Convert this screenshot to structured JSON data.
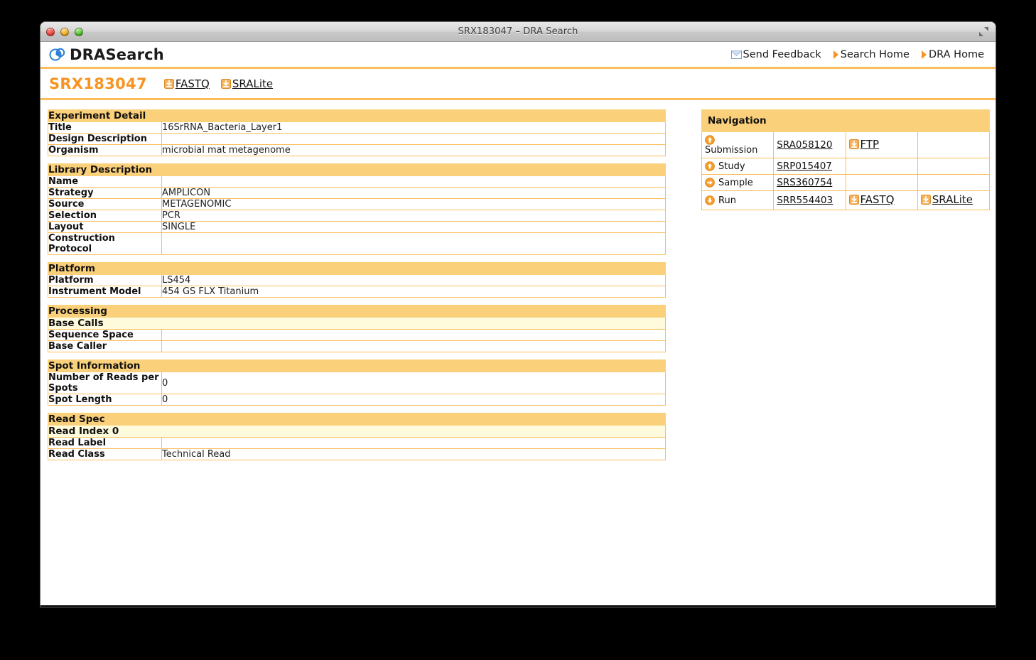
{
  "window": {
    "title": "SRX183047 – DRA Search",
    "controls": [
      "close",
      "minimize",
      "zoom"
    ],
    "fullscreen_icon": "fullscreen-icon"
  },
  "header": {
    "brand": "DRASearch",
    "logo_icon": "dra-logo-icon",
    "links": [
      {
        "label": "Send Feedback",
        "icon": "mail-icon"
      },
      {
        "label": "Search Home",
        "icon": "triangle-right-icon"
      },
      {
        "label": "DRA Home",
        "icon": "triangle-right-icon"
      }
    ]
  },
  "id_bar": {
    "accession": "SRX183047",
    "downloads": [
      {
        "label": "FASTQ",
        "icon": "download-icon"
      },
      {
        "label": "SRALite",
        "icon": "download-icon"
      }
    ]
  },
  "sections": [
    {
      "title": "Experiment Detail",
      "rows": [
        {
          "key": "Title",
          "value": "16SrRNA_Bacteria_Layer1"
        },
        {
          "key": "Design Description",
          "value": ""
        },
        {
          "key": "Organism",
          "value": "microbial mat metagenome"
        }
      ]
    },
    {
      "title": "Library Description",
      "rows": [
        {
          "key": "Name",
          "value": ""
        },
        {
          "key": "Strategy",
          "value": "AMPLICON"
        },
        {
          "key": "Source",
          "value": "METAGENOMIC"
        },
        {
          "key": "Selection",
          "value": "PCR"
        },
        {
          "key": "Layout",
          "value": "SINGLE"
        },
        {
          "key": "Construction Protocol",
          "value": ""
        }
      ]
    },
    {
      "title": "Platform",
      "rows": [
        {
          "key": "Platform",
          "value": "LS454"
        },
        {
          "key": "Instrument Model",
          "value": "454 GS FLX Titanium"
        }
      ]
    },
    {
      "title": "Processing",
      "rows": [
        {
          "key": "Base Calls",
          "value": "",
          "subhead": true
        },
        {
          "key": "Sequence Space",
          "value": ""
        },
        {
          "key": "Base Caller",
          "value": ""
        }
      ]
    },
    {
      "title": "Spot Information",
      "rows": [
        {
          "key": "Number of Reads per Spots",
          "value": "0"
        },
        {
          "key": "Spot Length",
          "value": "0"
        }
      ]
    },
    {
      "title": "Read Spec",
      "rows": [
        {
          "key": "Read Index 0",
          "value": "",
          "subhead": true
        },
        {
          "key": "Read Label",
          "value": ""
        },
        {
          "key": "Read Class",
          "value": "Technical Read"
        }
      ]
    }
  ],
  "navigation": {
    "title": "Navigation",
    "rows": [
      {
        "arrow": "arrow-up-icon",
        "label": "Submission",
        "accession": "SRA058120",
        "downloads": [
          {
            "label": "FTP",
            "icon": "download-icon"
          }
        ]
      },
      {
        "arrow": "arrow-up-icon",
        "label": "Study",
        "accession": "SRP015407",
        "downloads": []
      },
      {
        "arrow": "arrow-right-icon",
        "label": "Sample",
        "accession": "SRS360754",
        "downloads": []
      },
      {
        "arrow": "arrow-down-icon",
        "label": "Run",
        "accession": "SRR554403",
        "downloads": [
          {
            "label": "FASTQ",
            "icon": "download-icon"
          },
          {
            "label": "SRALite",
            "icon": "download-icon"
          }
        ]
      }
    ]
  },
  "colors": {
    "accent_orange": "#f79421",
    "section_header": "#fbd07a",
    "subheader": "#fdfbdc",
    "border": "#fbbd5b",
    "desktop": "#000000"
  }
}
